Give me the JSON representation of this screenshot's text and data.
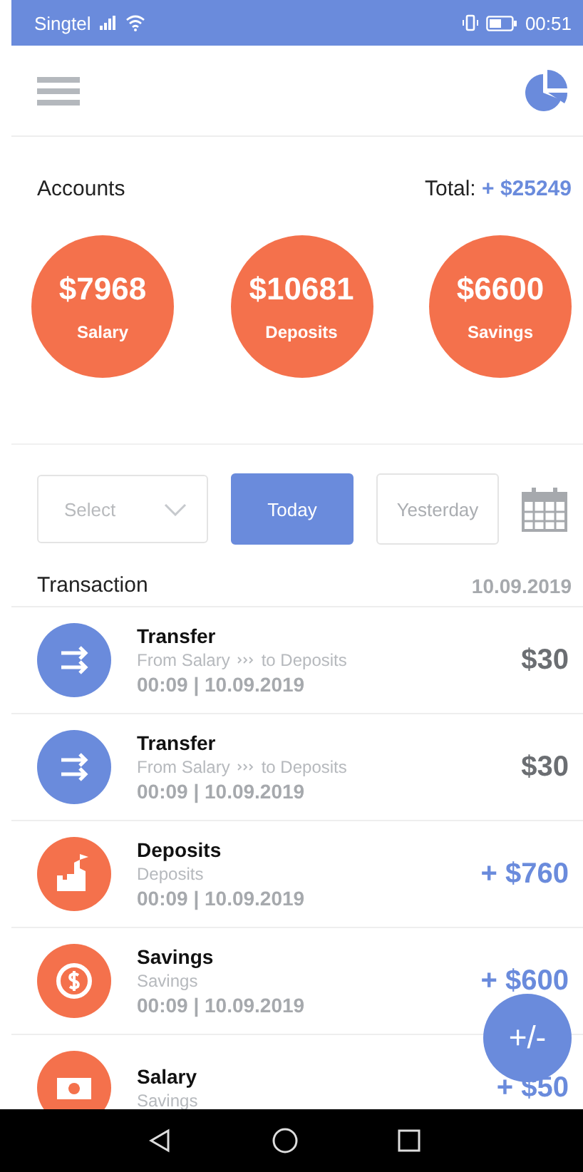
{
  "status_bar": {
    "carrier": "Singtel",
    "time": "00:51"
  },
  "accounts": {
    "title": "Accounts",
    "total_label": "Total:",
    "total_value": "+ $25249",
    "items": [
      {
        "amount": "$7968",
        "name": "Salary"
      },
      {
        "amount": "$10681",
        "name": "Deposits"
      },
      {
        "amount": "$6600",
        "name": "Savings"
      }
    ]
  },
  "filter": {
    "select": {
      "placeholder": "Select"
    },
    "tabs": [
      {
        "label": "Today",
        "selected": true
      },
      {
        "label": "Yesterday",
        "selected": false
      }
    ]
  },
  "transactions": {
    "title": "Transaction",
    "date": "10.09.2019",
    "rows": [
      {
        "kind": "transfer",
        "title": "Transfer",
        "from": "From Salary",
        "to": "to Deposits",
        "time": "00:09 | 10.09.2019",
        "amount": "$30",
        "incoming": false
      },
      {
        "kind": "transfer",
        "title": "Transfer",
        "from": "From Salary",
        "to": "to Deposits",
        "time": "00:09 | 10.09.2019",
        "amount": "$30",
        "incoming": false
      },
      {
        "kind": "deposits",
        "title": "Deposits",
        "from": "Deposits",
        "time": "00:09 | 10.09.2019",
        "amount": "+ $760",
        "incoming": true
      },
      {
        "kind": "savings",
        "title": "Savings",
        "from": "Savings",
        "time": "00:09 | 10.09.2019",
        "amount": "+ $600",
        "incoming": true
      },
      {
        "kind": "salary",
        "title": "Salary",
        "from": "Savings",
        "amount": "+ $50",
        "incoming": true
      }
    ]
  },
  "fab": {
    "label": "+/-"
  }
}
